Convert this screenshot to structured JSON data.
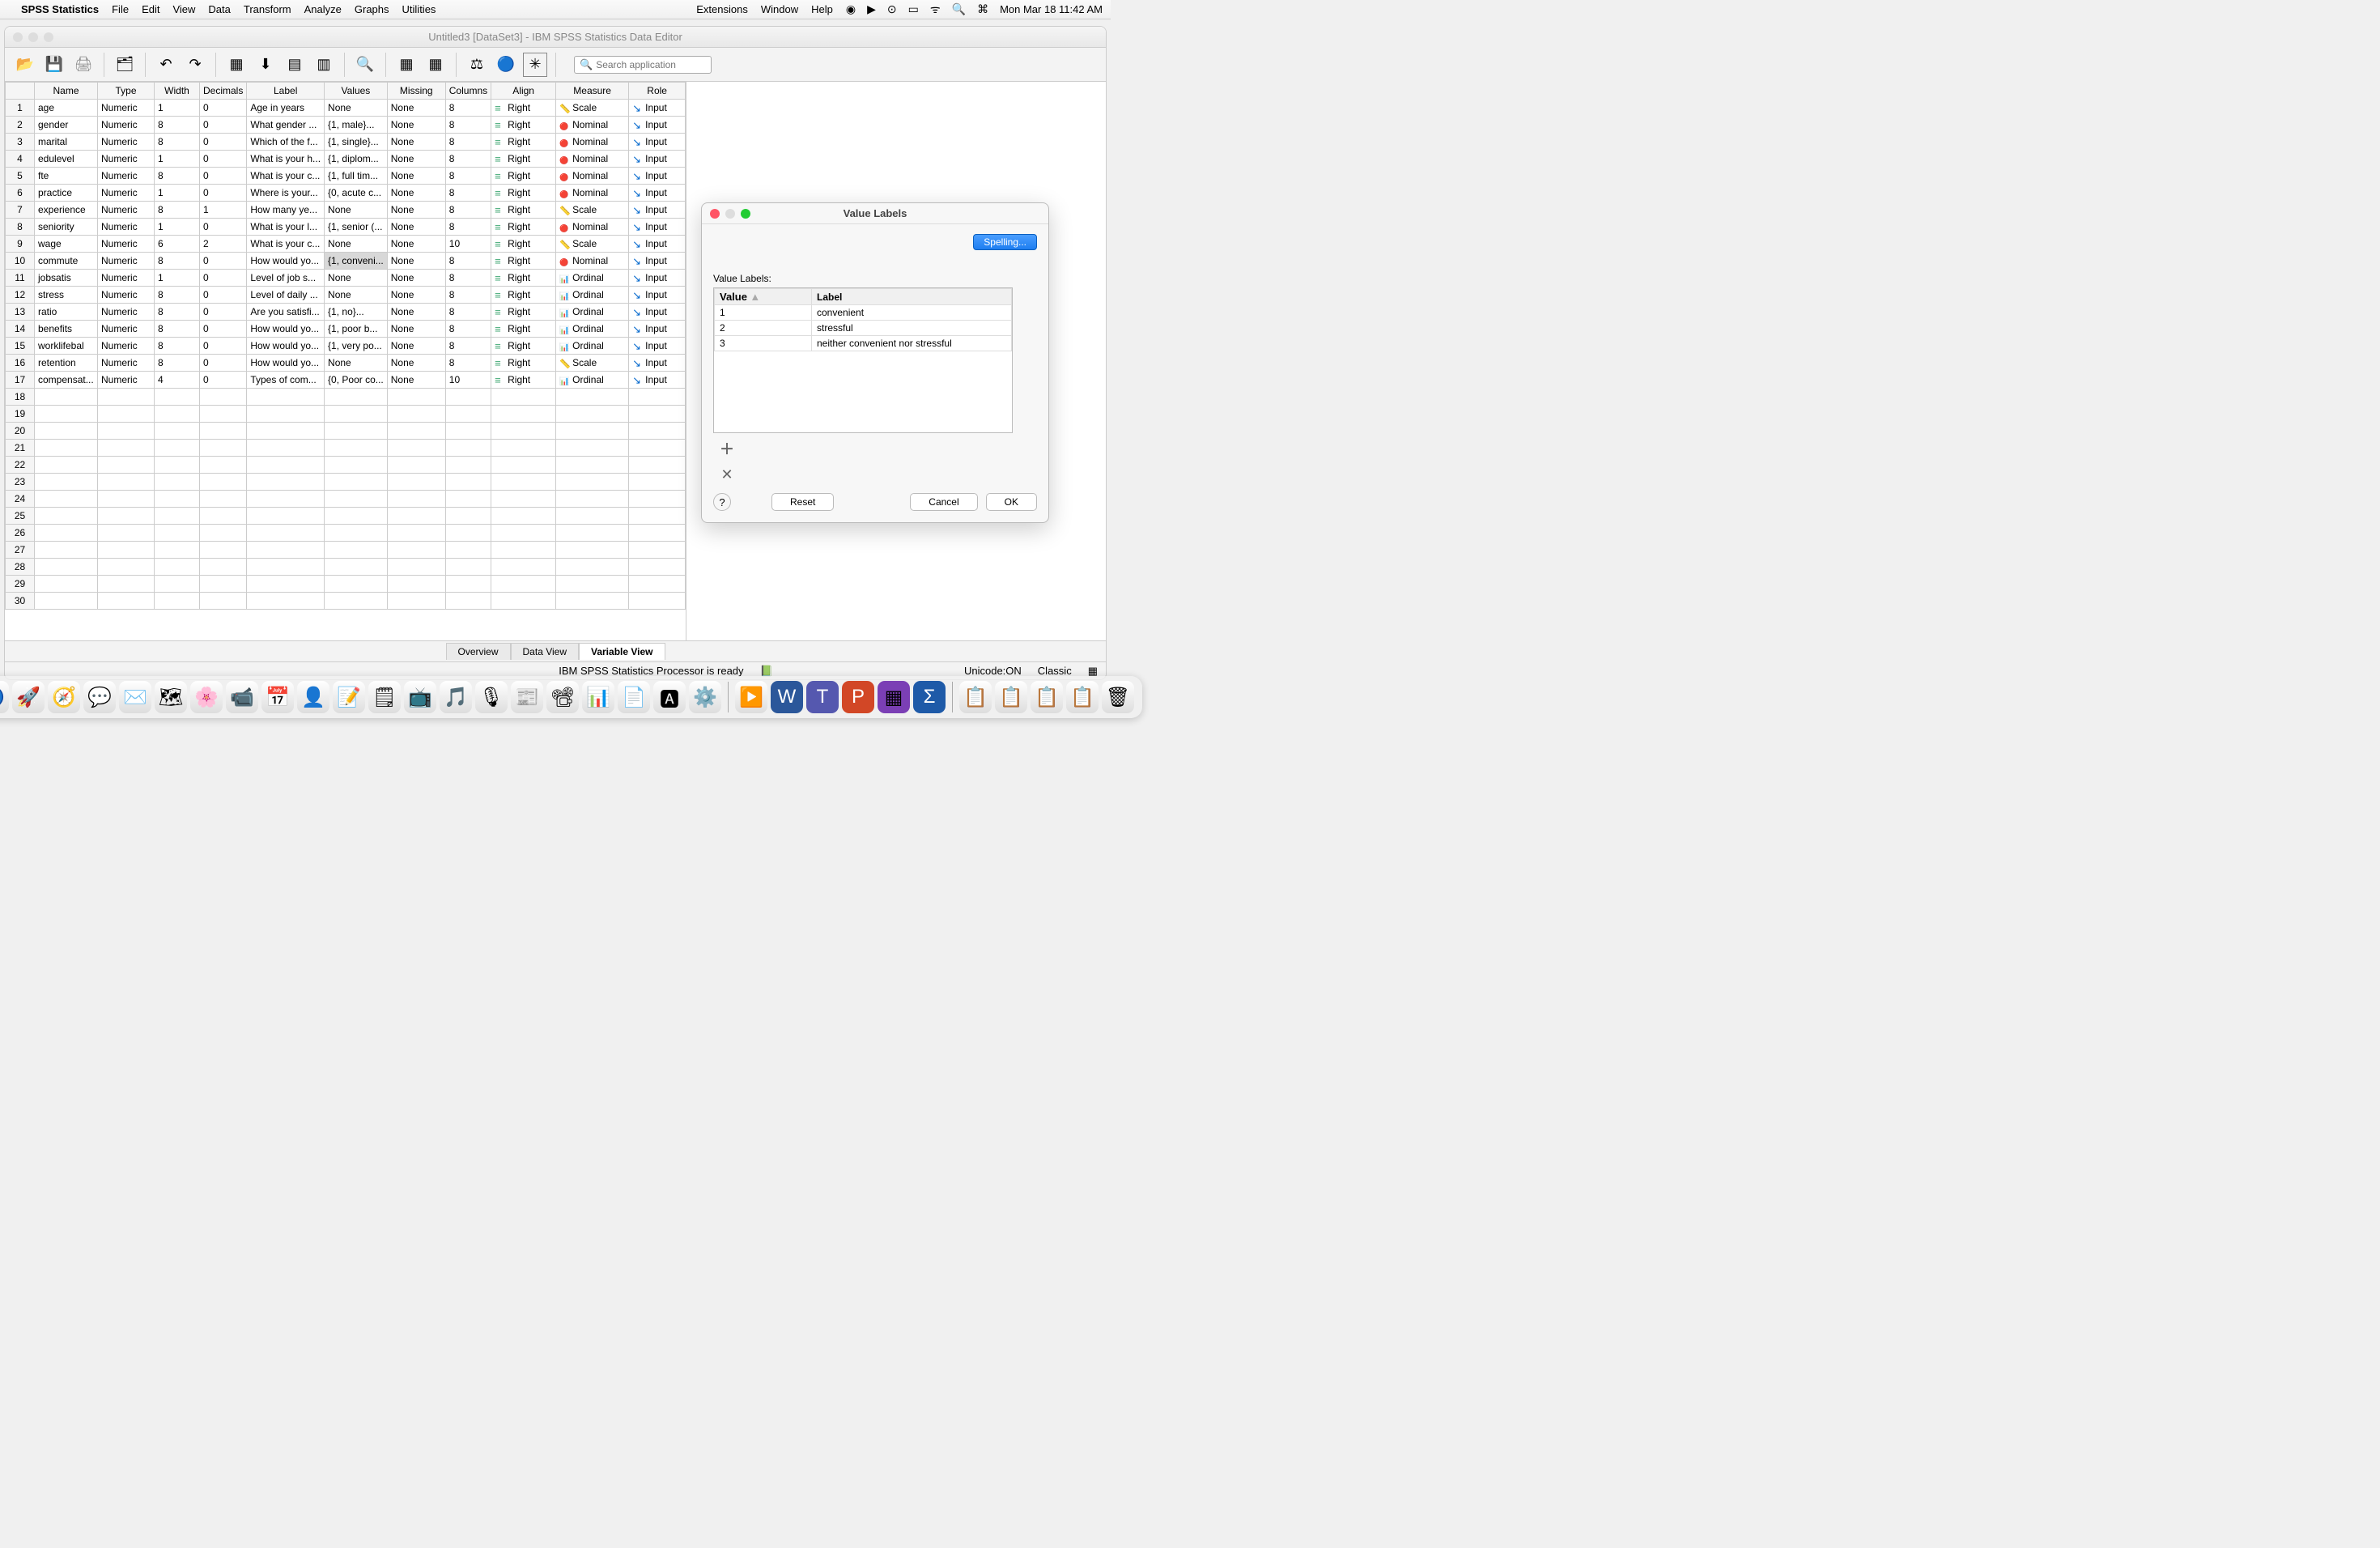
{
  "menubar": {
    "app": "SPSS Statistics",
    "items": [
      "File",
      "Edit",
      "View",
      "Data",
      "Transform",
      "Analyze",
      "Graphs",
      "Utilities"
    ],
    "right_items": [
      "Extensions",
      "Window",
      "Help"
    ],
    "datetime": "Mon Mar 18  11:42 AM"
  },
  "window": {
    "title": "Untitled3 [DataSet3] - IBM SPSS Statistics Data Editor",
    "search_placeholder": "Search application"
  },
  "columns": [
    "Name",
    "Type",
    "Width",
    "Decimals",
    "Label",
    "Values",
    "Missing",
    "Columns",
    "Align",
    "Measure",
    "Role"
  ],
  "rows": [
    {
      "n": "1",
      "name": "age",
      "type": "Numeric",
      "width": "1",
      "dec": "0",
      "label": "Age in years",
      "values": "None",
      "missing": "None",
      "cols": "8",
      "align": "Right",
      "measure": "Scale",
      "role": "Input"
    },
    {
      "n": "2",
      "name": "gender",
      "type": "Numeric",
      "width": "8",
      "dec": "0",
      "label": "What gender ...",
      "values": "{1, male}...",
      "missing": "None",
      "cols": "8",
      "align": "Right",
      "measure": "Nominal",
      "role": "Input"
    },
    {
      "n": "3",
      "name": "marital",
      "type": "Numeric",
      "width": "8",
      "dec": "0",
      "label": "Which of the f...",
      "values": "{1, single}...",
      "missing": "None",
      "cols": "8",
      "align": "Right",
      "measure": "Nominal",
      "role": "Input"
    },
    {
      "n": "4",
      "name": "edulevel",
      "type": "Numeric",
      "width": "1",
      "dec": "0",
      "label": "What is your h...",
      "values": "{1, diplom...",
      "missing": "None",
      "cols": "8",
      "align": "Right",
      "measure": "Nominal",
      "role": "Input"
    },
    {
      "n": "5",
      "name": "fte",
      "type": "Numeric",
      "width": "8",
      "dec": "0",
      "label": "What is your c...",
      "values": "{1, full tim...",
      "missing": "None",
      "cols": "8",
      "align": "Right",
      "measure": "Nominal",
      "role": "Input"
    },
    {
      "n": "6",
      "name": "practice",
      "type": "Numeric",
      "width": "1",
      "dec": "0",
      "label": "Where is your...",
      "values": "{0, acute c...",
      "missing": "None",
      "cols": "8",
      "align": "Right",
      "measure": "Nominal",
      "role": "Input"
    },
    {
      "n": "7",
      "name": "experience",
      "type": "Numeric",
      "width": "8",
      "dec": "1",
      "label": "How many ye...",
      "values": "None",
      "missing": "None",
      "cols": "8",
      "align": "Right",
      "measure": "Scale",
      "role": "Input"
    },
    {
      "n": "8",
      "name": "seniority",
      "type": "Numeric",
      "width": "1",
      "dec": "0",
      "label": "What is your l...",
      "values": "{1, senior (...",
      "missing": "None",
      "cols": "8",
      "align": "Right",
      "measure": "Nominal",
      "role": "Input"
    },
    {
      "n": "9",
      "name": "wage",
      "type": "Numeric",
      "width": "6",
      "dec": "2",
      "label": "What is your c...",
      "values": "None",
      "missing": "None",
      "cols": "10",
      "align": "Right",
      "measure": "Scale",
      "role": "Input"
    },
    {
      "n": "10",
      "name": "commute",
      "type": "Numeric",
      "width": "8",
      "dec": "0",
      "label": "How would yo...",
      "values": "{1, conveni...",
      "missing": "None",
      "cols": "8",
      "align": "Right",
      "measure": "Nominal",
      "role": "Input",
      "sel_values": true
    },
    {
      "n": "11",
      "name": "jobsatis",
      "type": "Numeric",
      "width": "1",
      "dec": "0",
      "label": "Level of job s...",
      "values": "None",
      "missing": "None",
      "cols": "8",
      "align": "Right",
      "measure": "Ordinal",
      "role": "Input"
    },
    {
      "n": "12",
      "name": "stress",
      "type": "Numeric",
      "width": "8",
      "dec": "0",
      "label": "Level of daily ...",
      "values": "None",
      "missing": "None",
      "cols": "8",
      "align": "Right",
      "measure": "Ordinal",
      "role": "Input"
    },
    {
      "n": "13",
      "name": "ratio",
      "type": "Numeric",
      "width": "8",
      "dec": "0",
      "label": "Are you satisfi...",
      "values": "{1, no}...",
      "missing": "None",
      "cols": "8",
      "align": "Right",
      "measure": "Ordinal",
      "role": "Input"
    },
    {
      "n": "14",
      "name": "benefits",
      "type": "Numeric",
      "width": "8",
      "dec": "0",
      "label": "How would yo...",
      "values": "{1, poor b...",
      "missing": "None",
      "cols": "8",
      "align": "Right",
      "measure": "Ordinal",
      "role": "Input"
    },
    {
      "n": "15",
      "name": "worklifebal",
      "type": "Numeric",
      "width": "8",
      "dec": "0",
      "label": "How would yo...",
      "values": "{1, very po...",
      "missing": "None",
      "cols": "8",
      "align": "Right",
      "measure": "Ordinal",
      "role": "Input"
    },
    {
      "n": "16",
      "name": "retention",
      "type": "Numeric",
      "width": "8",
      "dec": "0",
      "label": "How would yo...",
      "values": "None",
      "missing": "None",
      "cols": "8",
      "align": "Right",
      "measure": "Scale",
      "role": "Input"
    },
    {
      "n": "17",
      "name": "compensat...",
      "type": "Numeric",
      "width": "4",
      "dec": "0",
      "label": "Types of com...",
      "values": "{0, Poor co...",
      "missing": "None",
      "cols": "10",
      "align": "Right",
      "measure": "Ordinal",
      "role": "Input"
    }
  ],
  "empty_rows": [
    "18",
    "19",
    "20",
    "21",
    "22",
    "23",
    "24",
    "25",
    "26",
    "27",
    "28",
    "29",
    "30"
  ],
  "tabs": {
    "overview": "Overview",
    "data": "Data View",
    "variable": "Variable View"
  },
  "status": {
    "processor": "IBM SPSS Statistics Processor is ready",
    "unicode": "Unicode:ON",
    "classic": "Classic"
  },
  "dialog": {
    "title": "Value Labels",
    "spelling": "Spelling...",
    "section": "Value Labels:",
    "col_value": "Value",
    "col_label": "Label",
    "entries": [
      {
        "v": "1",
        "l": "convenient"
      },
      {
        "v": "2",
        "l": "stressful"
      },
      {
        "v": "3",
        "l": "neither convenient nor stressful"
      }
    ],
    "help": "?",
    "reset": "Reset",
    "cancel": "Cancel",
    "ok": "OK"
  }
}
